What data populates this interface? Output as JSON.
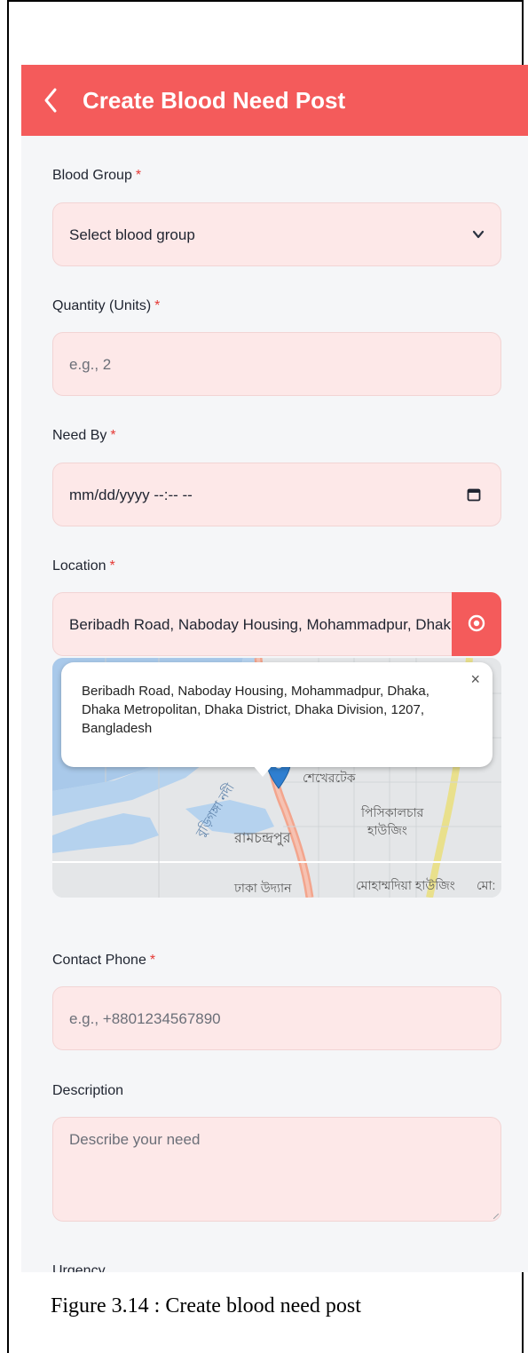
{
  "appbar": {
    "title": "Create Blood Need Post",
    "back_icon": "chevron-left-icon",
    "background": "#f45b5b"
  },
  "form": {
    "blood_group": {
      "label": "Blood Group",
      "required_mark": "*",
      "value": "Select blood group",
      "icon": "chevron-down-icon"
    },
    "quantity": {
      "label": "Quantity (Units)",
      "required_mark": "*",
      "placeholder": "e.g., 2"
    },
    "need_by": {
      "label": "Need By",
      "required_mark": "*",
      "placeholder": "mm/dd/yyyy --:-- --",
      "icon": "calendar-icon"
    },
    "location": {
      "label": "Location",
      "required_mark": "*",
      "value": "Beribadh Road, Naboday Housing, Mohammadpur, Dhaka, Dhaka Metropolitan, Dhaka District, Dhaka Division, 1207, Bangladesh",
      "button_icon": "location-target-icon"
    },
    "map": {
      "popup_text": "Beribadh Road, Naboday Housing, Mohammadpur, Dhaka, Dhaka Metropolitan, Dhaka District, Dhaka Division, 1207, Bangladesh",
      "popup_close": "×",
      "labels": [
        "শেখেরটেক",
        "পিসিকালচার",
        "হাউজিং",
        "রামচন্দ্রপুর",
        "ঢাকা উদ্যান",
        "মোহাম্মদিয়া হাউজিং",
        "মো:",
        "বুড়িগঙ্গা নদী"
      ]
    },
    "contact_phone": {
      "label": "Contact Phone",
      "required_mark": "*",
      "placeholder": "e.g., +8801234567890"
    },
    "description": {
      "label": "Description",
      "placeholder": "Describe your need"
    },
    "urgency": {
      "label": "Urgency"
    }
  },
  "caption": "Figure 3.14 : Create blood need post"
}
